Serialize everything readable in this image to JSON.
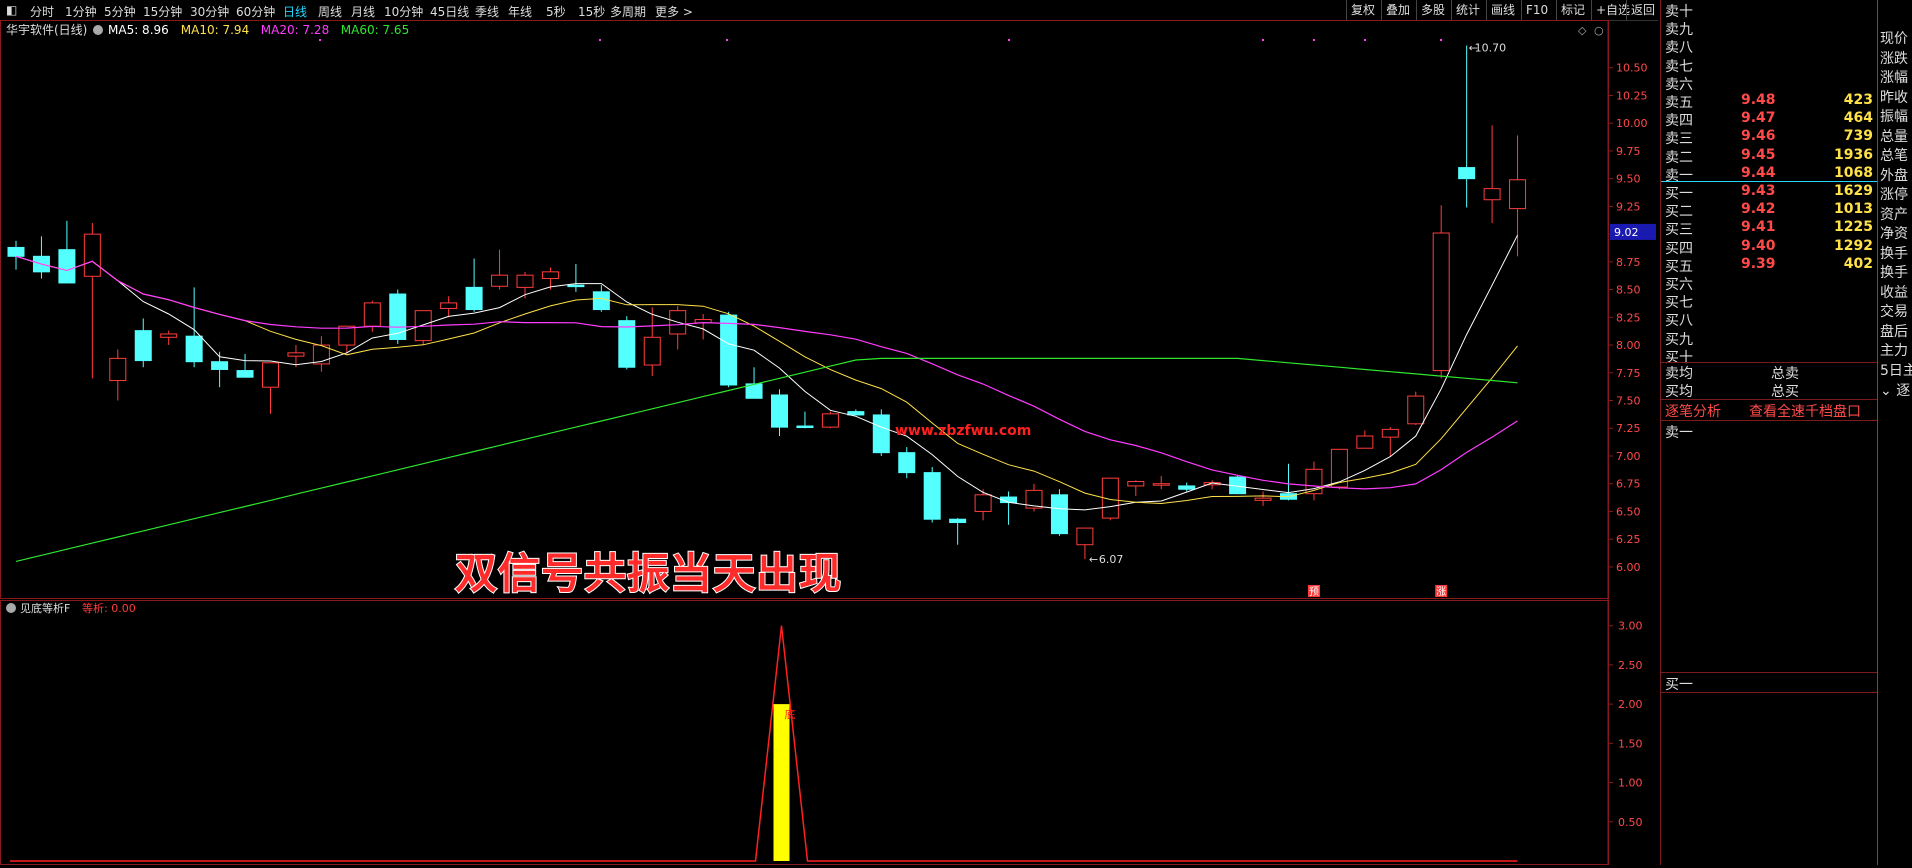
{
  "toolbar": {
    "periods": [
      "分时",
      "1分钟",
      "5分钟",
      "15分钟",
      "30分钟",
      "60分钟",
      "日线",
      "周线",
      "月线",
      "10分钟",
      "45日线",
      "季线",
      "年线",
      "5秒",
      "15秒",
      "多周期",
      "更多 >"
    ],
    "active_period": "日线",
    "right_buttons": [
      "复权",
      "叠加",
      "多股",
      "统计",
      "画线",
      "F10",
      "标记",
      "+自选",
      "返回"
    ]
  },
  "main_chart": {
    "title": "华宇软件(日线)",
    "ma_labels": [
      {
        "text": "MA5: 8.96",
        "color": "#ffffff"
      },
      {
        "text": "MA10: 7.94",
        "color": "#ffe14a"
      },
      {
        "text": "MA20: 7.28",
        "color": "#ff3cff"
      },
      {
        "text": "MA60: 7.65",
        "color": "#2ee62e"
      }
    ],
    "y_ticks": [
      "10.50",
      "10.25",
      "10.00",
      "9.75",
      "9.50",
      "9.25",
      "9.00",
      "8.75",
      "8.50",
      "8.25",
      "8.00",
      "7.75",
      "7.50",
      "7.25",
      "7.00",
      "6.75",
      "6.50",
      "6.25",
      "6.00"
    ],
    "current_price_tag": "9.02",
    "high_annotation": "10.70",
    "low_annotation": "6.07",
    "marker_yu": "预",
    "marker_zhang": "涨",
    "ylim": [
      5.9,
      10.75
    ]
  },
  "candles": [
    [
      8.88,
      8.94,
      8.68,
      8.8
    ],
    [
      8.8,
      8.98,
      8.6,
      8.66
    ],
    [
      8.86,
      9.12,
      8.76,
      8.56
    ],
    [
      8.62,
      9.1,
      7.7,
      9.0
    ],
    [
      7.68,
      7.96,
      7.5,
      7.88
    ],
    [
      8.13,
      8.24,
      7.8,
      7.86
    ],
    [
      8.07,
      8.13,
      8.0,
      8.1
    ],
    [
      8.08,
      8.52,
      7.8,
      7.85
    ],
    [
      7.85,
      7.94,
      7.62,
      7.78
    ],
    [
      7.77,
      7.92,
      7.72,
      7.71
    ],
    [
      7.62,
      7.8,
      7.38,
      7.84
    ],
    [
      7.9,
      8.0,
      7.8,
      7.93
    ],
    [
      7.83,
      8.08,
      7.76,
      8.0
    ],
    [
      8.0,
      8.15,
      7.92,
      8.17
    ],
    [
      8.17,
      8.4,
      8.12,
      8.38
    ],
    [
      8.46,
      8.5,
      8.01,
      8.05
    ],
    [
      8.04,
      8.3,
      8.0,
      8.31
    ],
    [
      8.33,
      8.44,
      8.25,
      8.38
    ],
    [
      8.52,
      8.78,
      8.3,
      8.32
    ],
    [
      8.53,
      8.86,
      8.5,
      8.63
    ],
    [
      8.52,
      8.66,
      8.42,
      8.63
    ],
    [
      8.6,
      8.7,
      8.5,
      8.66
    ],
    [
      8.54,
      8.73,
      8.48,
      8.53
    ],
    [
      8.48,
      8.54,
      8.3,
      8.32
    ],
    [
      8.22,
      8.26,
      7.78,
      7.8
    ],
    [
      7.82,
      8.34,
      7.72,
      8.07
    ],
    [
      8.1,
      8.35,
      7.96,
      8.31
    ],
    [
      8.2,
      8.28,
      8.05,
      8.23
    ],
    [
      8.27,
      8.3,
      7.62,
      7.64
    ],
    [
      7.65,
      7.8,
      7.6,
      7.52
    ],
    [
      7.55,
      7.6,
      7.18,
      7.26
    ],
    [
      7.27,
      7.4,
      7.25,
      7.26
    ],
    [
      7.26,
      7.4,
      7.25,
      7.38
    ],
    [
      7.4,
      7.42,
      7.38,
      7.37
    ],
    [
      7.37,
      7.42,
      7.0,
      7.03
    ],
    [
      7.03,
      7.08,
      6.8,
      6.85
    ],
    [
      6.85,
      6.9,
      6.4,
      6.43
    ],
    [
      6.43,
      6.44,
      6.2,
      6.4
    ],
    [
      6.5,
      6.7,
      6.42,
      6.65
    ],
    [
      6.63,
      6.68,
      6.38,
      6.58
    ],
    [
      6.53,
      6.75,
      6.5,
      6.69
    ],
    [
      6.65,
      6.7,
      6.28,
      6.3
    ],
    [
      6.2,
      6.35,
      6.07,
      6.35
    ],
    [
      6.44,
      6.8,
      6.42,
      6.8
    ],
    [
      6.73,
      6.78,
      6.64,
      6.77
    ],
    [
      6.74,
      6.82,
      6.7,
      6.75
    ],
    [
      6.73,
      6.76,
      6.68,
      6.7
    ],
    [
      6.74,
      6.78,
      6.7,
      6.76
    ],
    [
      6.81,
      6.82,
      6.68,
      6.66
    ],
    [
      6.6,
      6.68,
      6.55,
      6.62
    ],
    [
      6.66,
      6.93,
      6.6,
      6.61
    ],
    [
      6.66,
      6.95,
      6.6,
      6.88
    ],
    [
      6.72,
      7.06,
      6.7,
      7.06
    ],
    [
      7.07,
      7.23,
      7.07,
      7.18
    ],
    [
      7.17,
      7.26,
      7.0,
      7.24
    ],
    [
      7.29,
      7.58,
      7.28,
      7.54
    ],
    [
      7.77,
      9.26,
      7.7,
      9.01
    ],
    [
      9.6,
      10.7,
      9.24,
      9.5
    ],
    [
      9.31,
      9.98,
      9.1,
      9.41
    ],
    [
      9.23,
      9.89,
      8.8,
      9.49
    ]
  ],
  "lower_chart": {
    "title": "见底等析F",
    "value_label": "等析: 0.00",
    "y_ticks": [
      "3.00",
      "2.50",
      "2.00",
      "1.50",
      "1.00",
      "0.50"
    ],
    "bar_label": "底",
    "ylim": [
      0,
      3.2
    ]
  },
  "order_book": {
    "asks": [
      {
        "label": "卖十",
        "price": "",
        "vol": ""
      },
      {
        "label": "卖九",
        "price": "",
        "vol": ""
      },
      {
        "label": "卖八",
        "price": "",
        "vol": ""
      },
      {
        "label": "卖七",
        "price": "",
        "vol": ""
      },
      {
        "label": "卖六",
        "price": "",
        "vol": ""
      },
      {
        "label": "卖五",
        "price": "9.48",
        "vol": "423"
      },
      {
        "label": "卖四",
        "price": "9.47",
        "vol": "464"
      },
      {
        "label": "卖三",
        "price": "9.46",
        "vol": "739"
      },
      {
        "label": "卖二",
        "price": "9.45",
        "vol": "1936"
      },
      {
        "label": "卖一",
        "price": "9.44",
        "vol": "1068"
      }
    ],
    "bids": [
      {
        "label": "买一",
        "price": "9.43",
        "vol": "1629"
      },
      {
        "label": "买二",
        "price": "9.42",
        "vol": "1013"
      },
      {
        "label": "买三",
        "price": "9.41",
        "vol": "1225"
      },
      {
        "label": "买四",
        "price": "9.40",
        "vol": "1292"
      },
      {
        "label": "买五",
        "price": "9.39",
        "vol": "402"
      },
      {
        "label": "买六",
        "price": "",
        "vol": ""
      },
      {
        "label": "买七",
        "price": "",
        "vol": ""
      },
      {
        "label": "买八",
        "price": "",
        "vol": ""
      },
      {
        "label": "买九",
        "price": "",
        "vol": ""
      },
      {
        "label": "买十",
        "price": "",
        "vol": ""
      }
    ],
    "sell_avg_label": "卖均",
    "total_sell_label": "总卖",
    "buy_avg_label": "买均",
    "total_buy_label": "总买",
    "tick_analysis": "逐笔分析",
    "full_depth_link": "查看全速千档盘口",
    "sell1_label": "卖一",
    "buy1_label": "买一"
  },
  "far_panel": {
    "items": [
      "现价",
      "涨跌",
      "涨幅",
      "昨收",
      "振幅",
      "总量",
      "总笔",
      "外盘",
      "涨停",
      "资产",
      "净资",
      "换手",
      "换手",
      "收益",
      "交易",
      "盘后",
      "主力",
      "5日主"
    ],
    "collapse_label": "逐"
  },
  "overlay": {
    "watermark": "www.zbzfwu.com",
    "banner": "双信号共振当天出现"
  },
  "colors": {
    "up": "#ff3c3c",
    "down": "#54ffff",
    "ma5": "#ffffff",
    "ma10": "#ffe14a",
    "ma20": "#ff3cff",
    "ma60": "#2ee62e",
    "axis_red": "#8a1a1a"
  }
}
